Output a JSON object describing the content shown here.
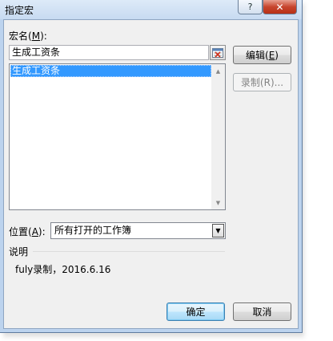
{
  "window": {
    "title": "指定宏"
  },
  "titlebar": {
    "help_glyph": "?",
    "close_glyph": "✕"
  },
  "macro_name": {
    "label": "宏名",
    "hotkey": "M",
    "value": "生成工资条"
  },
  "macro_list": {
    "items": [
      "生成工资条"
    ]
  },
  "buttons": {
    "edit_label": "编辑",
    "edit_hotkey": "E",
    "record_label": "录制(R)...",
    "ok_label": "确定",
    "cancel_label": "取消"
  },
  "location": {
    "label": "位置",
    "hotkey": "A",
    "selected": "所有打开的工作簿"
  },
  "description": {
    "label": "说明",
    "text": "fuly录制，2016.6.16"
  },
  "icons": {
    "scroll_up": "▲",
    "scroll_down": "▼",
    "combo_arrow": "▼"
  }
}
